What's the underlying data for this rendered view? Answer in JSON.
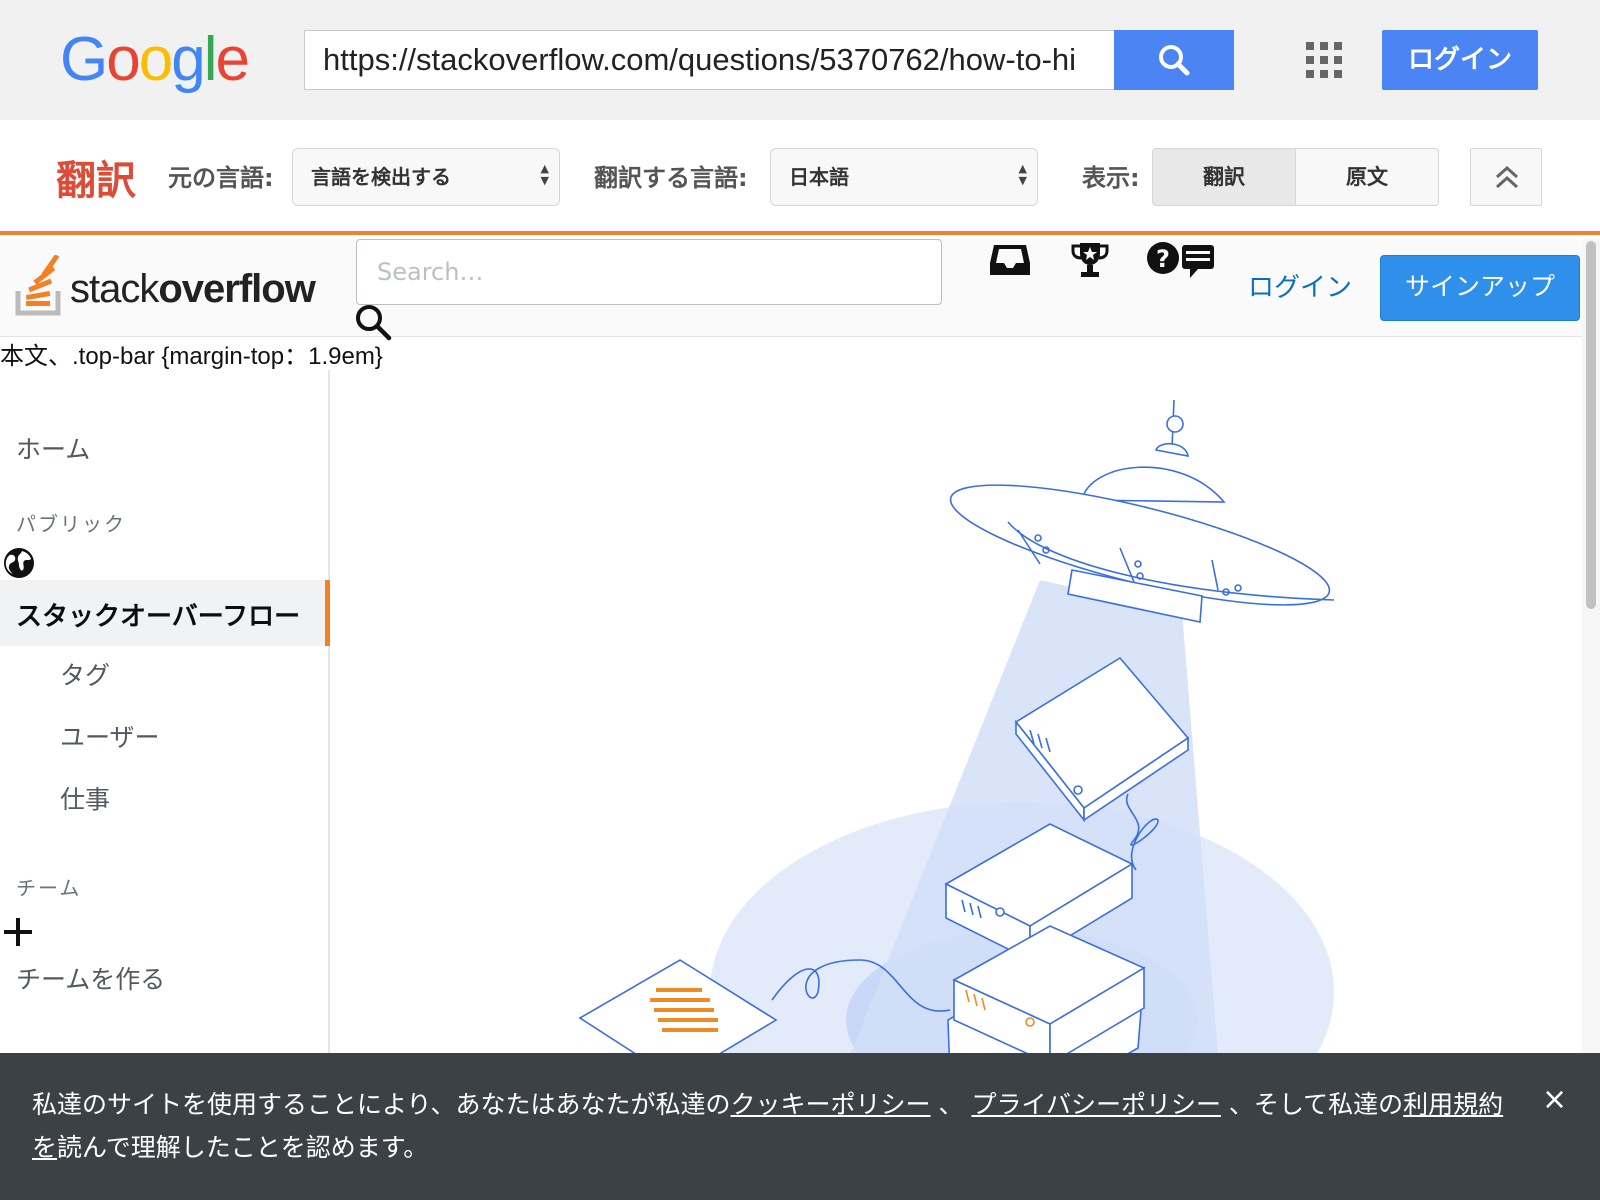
{
  "google_bar": {
    "logo": [
      "G",
      "o",
      "o",
      "g",
      "l",
      "e"
    ],
    "url": "https://stackoverflow.com/questions/5370762/how-to-hi",
    "search_button_icon": "search-icon",
    "apps_icon": "apps-grid-icon",
    "login_label": "ログイン"
  },
  "translate_bar": {
    "title": "翻訳",
    "source_label": "元の言語:",
    "source_value": "言語を検出する",
    "target_label": "翻訳する言語:",
    "target_value": "日本語",
    "view_label": "表示:",
    "view_translated": "翻訳",
    "view_original": "原文",
    "collapse_icon": "chevron-up-double-icon"
  },
  "so_header": {
    "logo_text_light": "stack",
    "logo_text_bold": "overflow",
    "search_placeholder": "Search…",
    "icons": [
      "inbox-icon",
      "trophy-icon",
      "help-icon"
    ],
    "login_label": "ログイン",
    "signup_label": "サインアップ"
  },
  "raw_css_text": "本文、.top-bar {margin-top：1.9em}",
  "sidebar": {
    "home": "ホーム",
    "public_heading": "パブリック",
    "active_item": "スタックオーバーフロー",
    "items": [
      "タグ",
      "ユーザー",
      "仕事"
    ],
    "teams_heading": "チーム",
    "create_team": "チームを作る"
  },
  "cookie_banner": {
    "text_1": "私達のサイトを使用することにより、あなたはあなたが私達の",
    "link_cookie": "クッキーポリシー",
    "sep_1": " 、 ",
    "link_privacy": "プライバシーポリシー",
    "text_2": " 、そして私達の",
    "link_terms": "利用規約を",
    "text_3": "読んで理解したことを認めます。",
    "close_label": "×"
  },
  "colors": {
    "google_blue": "#4a85f3",
    "so_orange": "#f48024",
    "so_blue": "#2f90ec",
    "translate_red": "#dd4b39",
    "banner_bg": "#3c4146",
    "illustration_blue": "#3b6ee0"
  }
}
